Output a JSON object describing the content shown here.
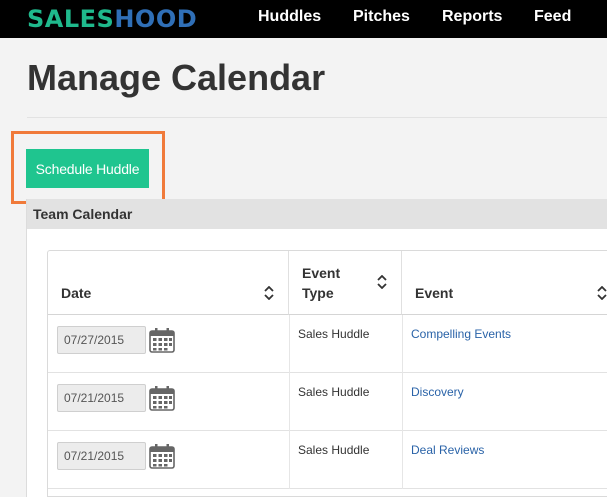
{
  "brand": {
    "part1": "SALES",
    "part2": "HOOD"
  },
  "nav": [
    {
      "label": "Huddles"
    },
    {
      "label": "Pitches"
    },
    {
      "label": "Reports"
    },
    {
      "label": "Feed"
    }
  ],
  "page": {
    "title": "Manage Calendar"
  },
  "actions": {
    "schedule_label": "Schedule Huddle"
  },
  "colors": {
    "accent": "#1fc58f",
    "highlight": "#f07a3a",
    "link": "#2a63a8",
    "brand_green": "#1fb98c",
    "brand_blue": "#2f6fb7"
  },
  "calendar": {
    "title": "Team Calendar",
    "columns": [
      {
        "label": "Date"
      },
      {
        "label": "Event\nType"
      },
      {
        "label": "Event"
      }
    ],
    "rows": [
      {
        "date": "07/27/2015",
        "type": "Sales Huddle",
        "event": "Compelling Events"
      },
      {
        "date": "07/21/2015",
        "type": "Sales Huddle",
        "event": "Discovery"
      },
      {
        "date": "07/21/2015",
        "type": "Sales Huddle",
        "event": "Deal Reviews"
      }
    ]
  }
}
